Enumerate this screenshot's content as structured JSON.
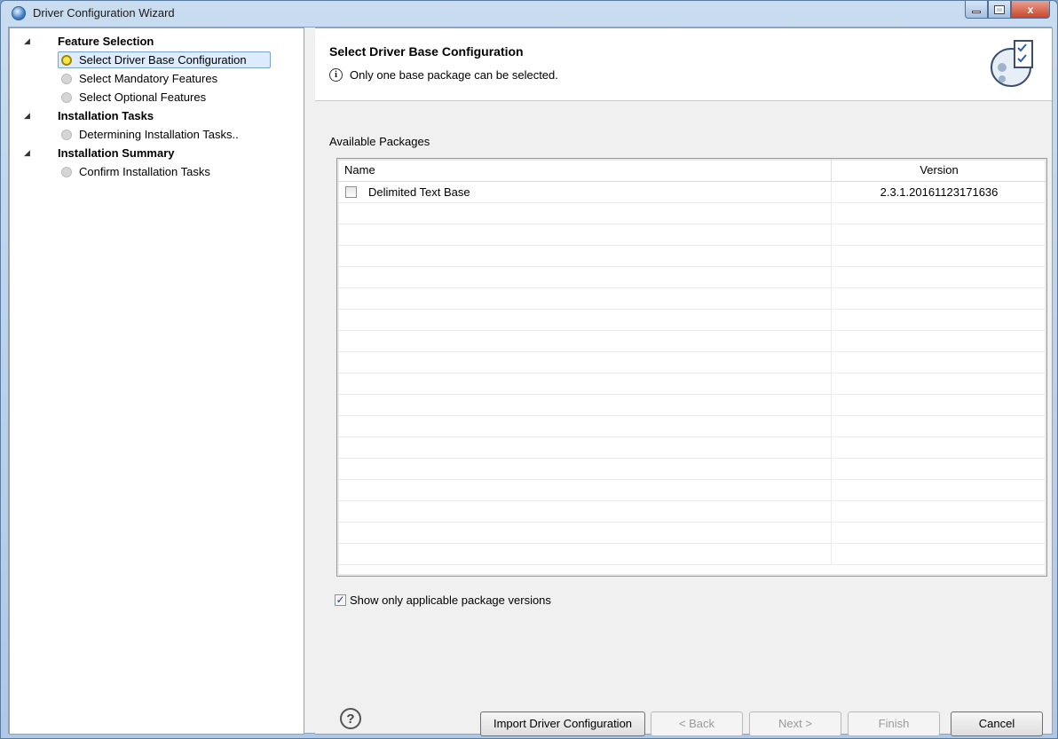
{
  "window": {
    "title": "Driver Configuration Wizard",
    "minimize_label": "",
    "maximize_label": "",
    "close_label": "x"
  },
  "tree": {
    "groups": [
      {
        "label": "Feature Selection",
        "expander": "◢",
        "items": [
          {
            "label": "Select Driver Base Configuration",
            "selected": true
          },
          {
            "label": "Select Mandatory Features",
            "selected": false
          },
          {
            "label": "Select Optional Features",
            "selected": false
          }
        ]
      },
      {
        "label": "Installation Tasks",
        "expander": "◢",
        "items": [
          {
            "label": "Determining Installation Tasks..",
            "selected": false
          }
        ]
      },
      {
        "label": "Installation Summary",
        "expander": "◢",
        "items": [
          {
            "label": "Confirm Installation Tasks",
            "selected": false
          }
        ]
      }
    ]
  },
  "page": {
    "title": "Select Driver Base Configuration",
    "message": "Only one base package can be selected.",
    "info_icon": "i",
    "section_label": "Available Packages"
  },
  "table": {
    "columns": {
      "name": "Name",
      "version": "Version"
    },
    "rows": [
      {
        "name": "Delimited Text Base",
        "version": "2.3.1.20161123171636",
        "checked": false
      }
    ],
    "empty_rows": 17
  },
  "options": {
    "show_applicable_label": "Show only applicable package versions",
    "show_applicable_checked": true,
    "check_mark": "✓"
  },
  "footer": {
    "help_icon": "?",
    "import_label": "Import Driver Configuration",
    "back_label": "< Back",
    "next_label": "Next >",
    "finish_label": "Finish",
    "cancel_label": "Cancel"
  },
  "colors": {
    "selection_bg": "#dcecfc",
    "selection_border": "#7da2ce",
    "selected_step": "#f8e44c",
    "close_button": "#c9462c"
  }
}
